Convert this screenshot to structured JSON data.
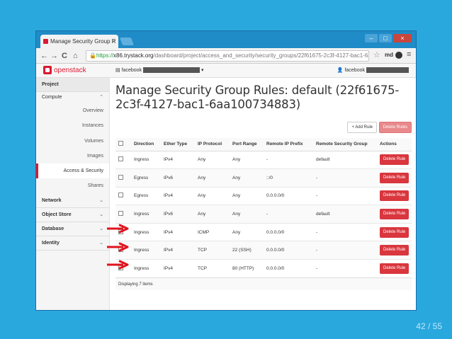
{
  "browser": {
    "tab_title": "Manage Security Group R",
    "tab_close": "×",
    "url_scheme": "https://",
    "url_host": "x86.trystack.org",
    "url_path": "/dashboard/project/access_and_security/security_groups/22f61675-2c3f-4127-bac1-6aa100734883/",
    "nav_back": "←",
    "nav_forward": "→",
    "nav_reload": "C",
    "nav_home": "⌂",
    "lock": "🔒",
    "star": "☆",
    "extension_label": "md",
    "menu": "≡",
    "win_minimize": "–",
    "win_maximize": "□",
    "win_close": "×"
  },
  "header": {
    "logo_text": "openstack",
    "project_prefix": "facebook",
    "project_caret": "▾",
    "user_icon": "👤",
    "user_prefix": "facebook"
  },
  "sidebar": {
    "project_label": "Project",
    "compute_label": "Compute",
    "compute_items": [
      "Overview",
      "Instances",
      "Volumes",
      "Images",
      "Access & Security",
      "Shares"
    ],
    "sections": [
      "Network",
      "Object Store",
      "Database",
      "Identity"
    ],
    "chev_up": "⌃",
    "chev_down": "⌄"
  },
  "main": {
    "title": "Manage Security Group Rules: default (22f61675-2c3f-4127-bac1-6aa100734883)",
    "add_rule": "+ Add Rule",
    "delete_rules": "Delete Rules",
    "columns": [
      "Direction",
      "Ether Type",
      "IP Protocol",
      "Port Range",
      "Remote IP Prefix",
      "Remote Security Group",
      "Actions"
    ],
    "rows": [
      [
        "Ingress",
        "IPv4",
        "Any",
        "Any",
        "-",
        "default"
      ],
      [
        "Egress",
        "IPv6",
        "Any",
        "Any",
        "::/0",
        "-"
      ],
      [
        "Egress",
        "IPv4",
        "Any",
        "Any",
        "0.0.0.0/0",
        "-"
      ],
      [
        "Ingress",
        "IPv6",
        "Any",
        "Any",
        "-",
        "default"
      ],
      [
        "Ingress",
        "IPv4",
        "ICMP",
        "Any",
        "0.0.0.0/0",
        "-"
      ],
      [
        "Ingress",
        "IPv4",
        "TCP",
        "22 (SSH)",
        "0.0.0.0/0",
        "-"
      ],
      [
        "Ingress",
        "IPv4",
        "TCP",
        "80 (HTTP)",
        "0.0.0.0/0",
        "-"
      ]
    ],
    "row_action": "Delete Rule",
    "footer": "Displaying 7 items"
  },
  "annotations": {
    "arrow_color": "#e0141e",
    "arrowed_rows": [
      4,
      5,
      6
    ]
  },
  "slide": {
    "page": "42 / 55"
  }
}
